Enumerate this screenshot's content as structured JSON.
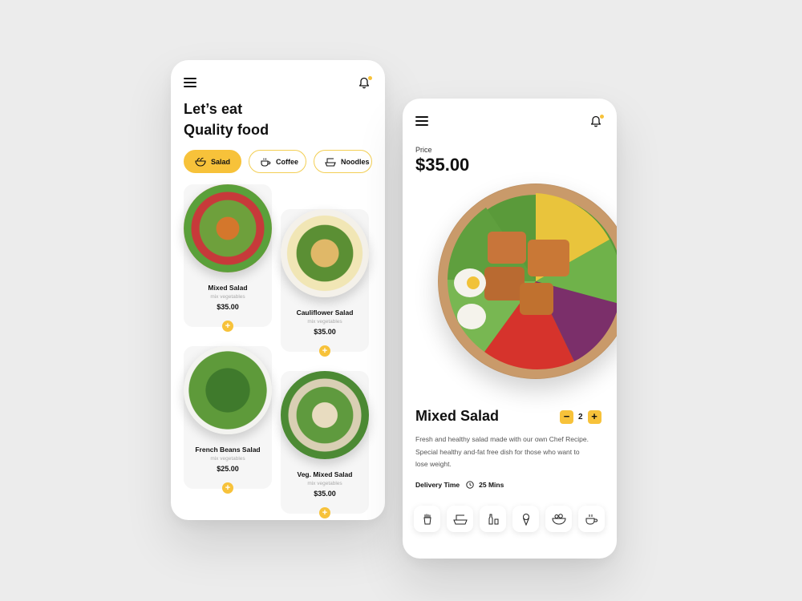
{
  "left_screen": {
    "headline_line1": "Let’s eat",
    "headline_line2": "Quality food",
    "categories": [
      {
        "label": "Salad",
        "active": true
      },
      {
        "label": "Coffee",
        "active": false
      },
      {
        "label": "Noodles",
        "active": false
      }
    ],
    "items": [
      {
        "name": "Mixed Salad",
        "subtitle": "mix vegetables",
        "price": "$35.00"
      },
      {
        "name": "Cauliflower Salad",
        "subtitle": "mix vegetables",
        "price": "$35.00"
      },
      {
        "name": "French Beans Salad",
        "subtitle": "mix vegetables",
        "price": "$25.00"
      },
      {
        "name": "Veg. Mixed Salad",
        "subtitle": "mix vegetables",
        "price": "$35.00"
      }
    ],
    "add_symbol": "+"
  },
  "right_screen": {
    "price_label": "Price",
    "price_value": "$35.00",
    "product_name": "Mixed Salad",
    "quantity": "2",
    "minus_symbol": "−",
    "plus_symbol": "+",
    "description": "Fresh and healthy salad made with our own Chef Recipe. Special healthy and-fat free dish for those who want to lose weight.",
    "delivery_label": "Delivery Time",
    "delivery_value": "25 Mins",
    "category_icons": [
      "fries-icon",
      "noodles-icon",
      "drinks-icon",
      "ice-cream-icon",
      "salad-icon",
      "coffee-icon"
    ]
  },
  "colors": {
    "accent": "#f7c23a",
    "background": "#ececec",
    "card": "#f6f6f6"
  }
}
